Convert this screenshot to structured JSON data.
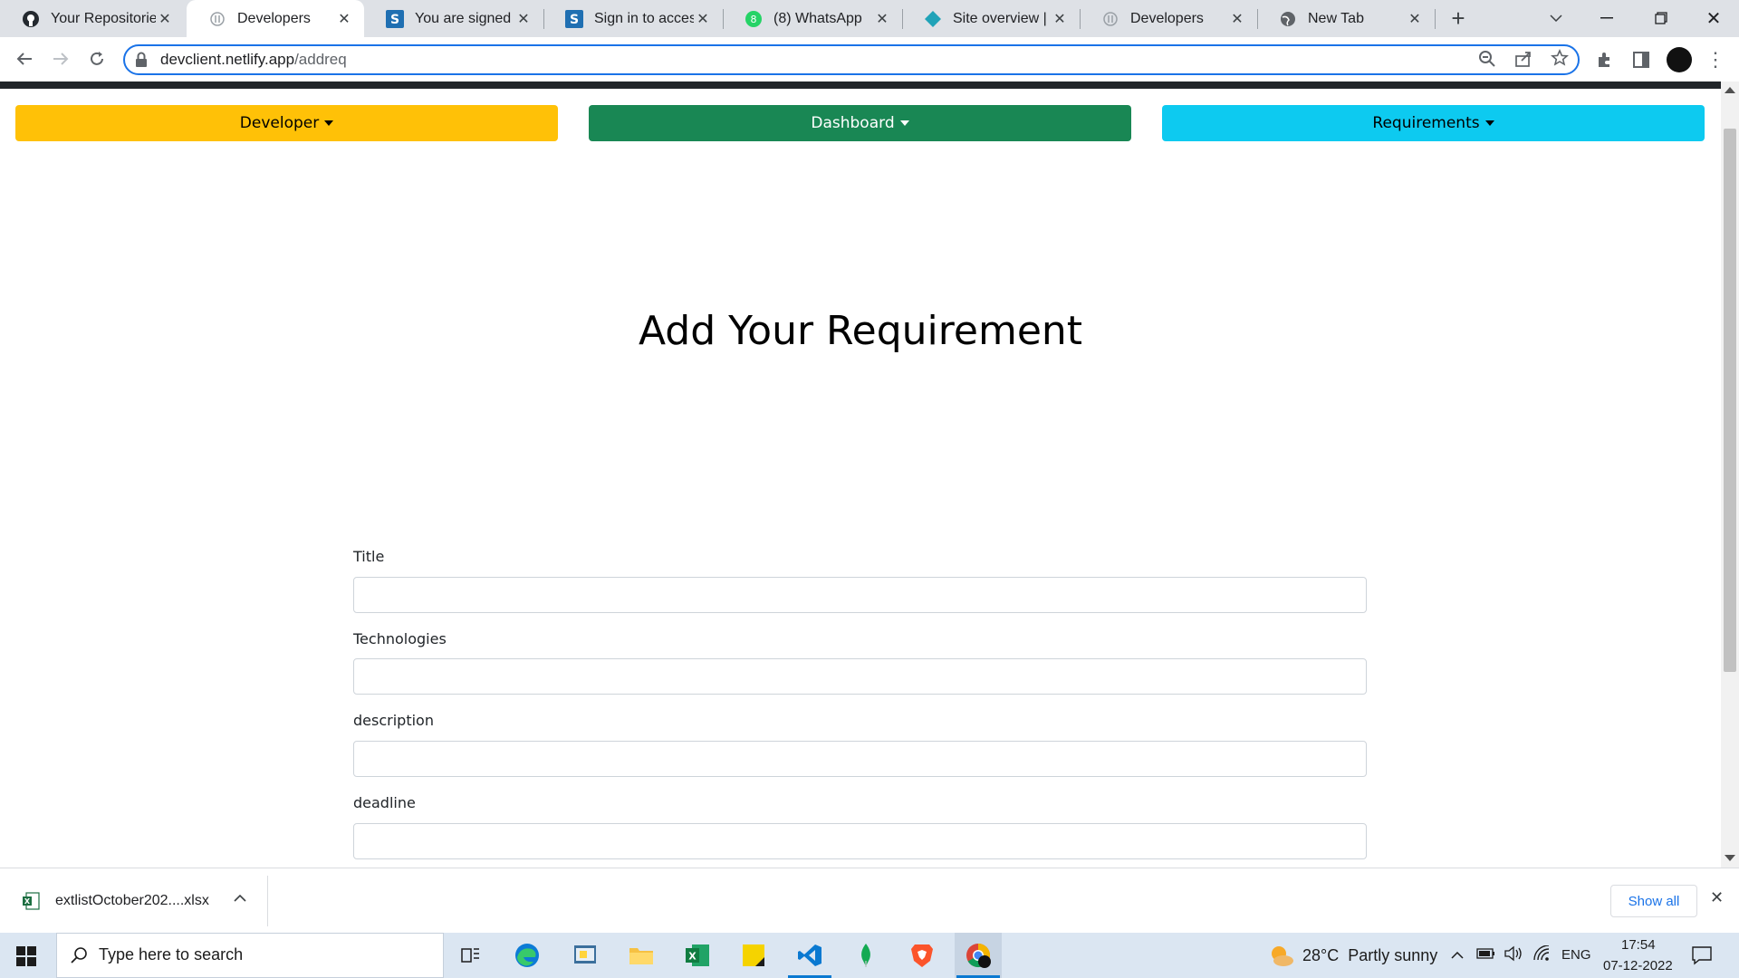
{
  "browser": {
    "tabs": [
      {
        "title": "Your Repositories",
        "icon": "github-icon",
        "active": false
      },
      {
        "title": "Developers",
        "icon": "page-icon",
        "active": true
      },
      {
        "title": "You are signed in",
        "icon": "s-icon",
        "active": false
      },
      {
        "title": "Sign in to access",
        "icon": "s-icon",
        "active": false
      },
      {
        "title": "(8) WhatsApp",
        "icon": "whatsapp-icon",
        "active": false
      },
      {
        "title": "Site overview | de",
        "icon": "netlify-icon",
        "active": false
      },
      {
        "title": "Developers",
        "icon": "page-icon",
        "active": false
      },
      {
        "title": "New Tab",
        "icon": "globe-icon",
        "active": false
      }
    ],
    "url_host": "devclient.netlify.app",
    "url_path": "/addreq"
  },
  "nav": {
    "developer": "Developer",
    "dashboard": "Dashboard",
    "requirements": "Requirements"
  },
  "page": {
    "heading": "Add Your Requirement"
  },
  "form": {
    "title_label": "Title",
    "technologies_label": "Technologies",
    "description_label": "description",
    "deadline_label": "deadline"
  },
  "download": {
    "filename": "extlistOctober202....xlsx",
    "show_all": "Show all"
  },
  "taskbar": {
    "search_placeholder": "Type here to search",
    "weather": "28°C  Partly sunny",
    "language": "ENG",
    "time": "17:54",
    "date": "07-12-2022"
  },
  "colors": {
    "developer_btn": "#ffc107",
    "dashboard_btn": "#198754",
    "requirements_btn": "#0dcaf0",
    "omnibox_focus": "#1a73e8"
  }
}
